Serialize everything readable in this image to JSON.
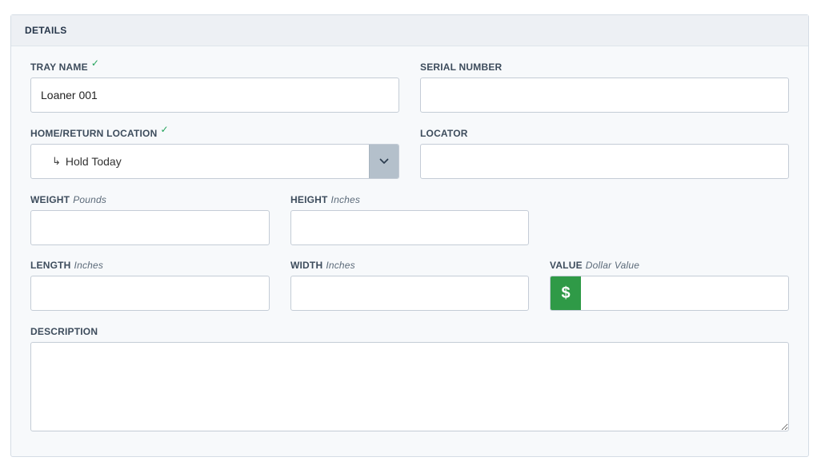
{
  "panel": {
    "title": "DETAILS"
  },
  "fields": {
    "tray_name": {
      "label": "TRAY NAME",
      "check": "✓",
      "value": "Loaner 001"
    },
    "serial_number": {
      "label": "SERIAL NUMBER",
      "value": ""
    },
    "home_location": {
      "label": "HOME/RETURN LOCATION",
      "check": "✓",
      "arrow": "↳",
      "value": "Hold Today"
    },
    "locator": {
      "label": "LOCATOR",
      "value": ""
    },
    "weight": {
      "label": "WEIGHT",
      "unit": "Pounds",
      "value": ""
    },
    "height": {
      "label": "HEIGHT",
      "unit": "Inches",
      "value": ""
    },
    "length": {
      "label": "LENGTH",
      "unit": "Inches",
      "value": ""
    },
    "width": {
      "label": "WIDTH",
      "unit": "Inches",
      "value": ""
    },
    "value": {
      "label": "VALUE",
      "unit": "Dollar Value",
      "addon": "$",
      "value": ""
    },
    "description": {
      "label": "DESCRIPTION",
      "value": ""
    }
  },
  "colors": {
    "check": "#22a35a",
    "money_addon": "#2f9a47",
    "select_button": "#b4c0cb"
  },
  "icons": {
    "select_toggle": "chevron-down-icon",
    "sub_location": "return-arrow-icon"
  }
}
